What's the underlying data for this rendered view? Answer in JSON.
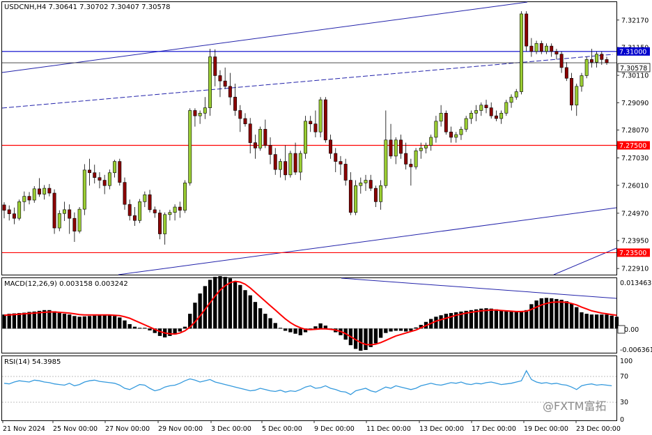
{
  "header": {
    "symbol_info": "USDCNH,H4  7.30641 7.30702 7.30407 7.30578"
  },
  "price_axis": {
    "ticks": [
      "7.32170",
      "7.31150",
      "7.30110",
      "7.29090",
      "7.28070",
      "7.27030",
      "7.26010",
      "7.24970",
      "7.23950",
      "7.22910"
    ],
    "current_price_label": "7.30578",
    "levels": [
      {
        "label": "7.31000",
        "value": 7.31,
        "color": "#0000cc"
      },
      {
        "label": "7.27500",
        "value": 7.275,
        "color": "#ff0000"
      },
      {
        "label": "7.23500",
        "value": 7.235,
        "color": "#ff0000"
      }
    ]
  },
  "macd": {
    "title": "MACD(12,26,9) 0.003158 0.003242",
    "ticks": [
      "0.013463",
      "0.00",
      "-0.006361"
    ]
  },
  "rsi": {
    "title": "RSI(14) 54.3985",
    "ticks": [
      "100",
      "70",
      "30",
      "0"
    ]
  },
  "time_axis": {
    "labels": [
      "21 Nov 2024",
      "25 Nov 00:00",
      "27 Nov 00:00",
      "29 Nov 00:00",
      "3 Dec 00:00",
      "5 Dec 00:00",
      "9 Dec 00:00",
      "11 Dec 00:00",
      "13 Dec 00:00",
      "17 Dec 00:00",
      "19 Dec 00:00",
      "23 Dec 00:00"
    ]
  },
  "watermark": "@FXTM富拓",
  "colors": {
    "bull": "#9acd32",
    "bear": "#8b0000",
    "signal": "#ff0000",
    "rsi": "#3399dd",
    "trend": "#2222aa"
  },
  "chart_data": {
    "type": "candlestick",
    "title": "USDCNH,H4",
    "ylim": [
      7.2268,
      7.3284
    ],
    "ohlc": [
      [
        7.2528,
        7.2538,
        7.2478,
        7.2508
      ],
      [
        7.251,
        7.2526,
        7.247,
        7.2495
      ],
      [
        7.2495,
        7.2518,
        7.2456,
        7.2478
      ],
      [
        7.2478,
        7.2548,
        7.247,
        7.254
      ],
      [
        7.254,
        7.2578,
        7.2505,
        7.256
      ],
      [
        7.256,
        7.2576,
        7.253,
        7.2546
      ],
      [
        7.2546,
        7.2598,
        7.2536,
        7.2588
      ],
      [
        7.2588,
        7.2628,
        7.2558,
        7.2568
      ],
      [
        7.2568,
        7.2602,
        7.2548,
        7.259
      ],
      [
        7.259,
        7.2606,
        7.256,
        7.2572
      ],
      [
        7.2572,
        7.2586,
        7.242,
        7.2442
      ],
      [
        7.2442,
        7.2508,
        7.243,
        7.2496
      ],
      [
        7.2496,
        7.254,
        7.2468,
        7.251
      ],
      [
        7.251,
        7.253,
        7.242,
        7.2478
      ],
      [
        7.2478,
        7.25,
        7.239,
        7.243
      ],
      [
        7.243,
        7.252,
        7.2422,
        7.2512
      ],
      [
        7.2512,
        7.268,
        7.249,
        7.2658
      ],
      [
        7.2658,
        7.27,
        7.26,
        7.2648
      ],
      [
        7.2648,
        7.2678,
        7.2608,
        7.263
      ],
      [
        7.263,
        7.265,
        7.259,
        7.262
      ],
      [
        7.262,
        7.264,
        7.2568,
        7.26
      ],
      [
        7.26,
        7.266,
        7.2586,
        7.2648
      ],
      [
        7.2648,
        7.2696,
        7.263,
        7.269
      ],
      [
        7.269,
        7.27,
        7.26,
        7.2612
      ],
      [
        7.2612,
        7.263,
        7.251,
        7.253
      ],
      [
        7.253,
        7.2548,
        7.247,
        7.2488
      ],
      [
        7.2488,
        7.252,
        7.245,
        7.247
      ],
      [
        7.247,
        7.255,
        7.246,
        7.254
      ],
      [
        7.254,
        7.2578,
        7.252,
        7.2566
      ],
      [
        7.2566,
        7.2584,
        7.25,
        7.251
      ],
      [
        7.251,
        7.2522,
        7.248,
        7.2498
      ],
      [
        7.2498,
        7.251,
        7.24,
        7.242
      ],
      [
        7.242,
        7.25,
        7.238,
        7.2492
      ],
      [
        7.2492,
        7.251,
        7.247,
        7.25
      ],
      [
        7.25,
        7.253,
        7.247,
        7.252
      ],
      [
        7.252,
        7.254,
        7.248,
        7.2508
      ],
      [
        7.2508,
        7.262,
        7.2498,
        7.261
      ],
      [
        7.261,
        7.2888,
        7.26,
        7.288
      ],
      [
        7.288,
        7.2888,
        7.282,
        7.286
      ],
      [
        7.286,
        7.288,
        7.283,
        7.287
      ],
      [
        7.287,
        7.293,
        7.2848,
        7.289
      ],
      [
        7.289,
        7.311,
        7.286,
        7.308
      ],
      [
        7.308,
        7.3108,
        7.297,
        7.301
      ],
      [
        7.301,
        7.303,
        7.293,
        7.299
      ],
      [
        7.299,
        7.304,
        7.296,
        7.297
      ],
      [
        7.297,
        7.302,
        7.29,
        7.293
      ],
      [
        7.293,
        7.298,
        7.286,
        7.288
      ],
      [
        7.288,
        7.29,
        7.28,
        7.285
      ],
      [
        7.285,
        7.287,
        7.282,
        7.283
      ],
      [
        7.283,
        7.2852,
        7.272,
        7.276
      ],
      [
        7.276,
        7.279,
        7.27,
        7.274
      ],
      [
        7.274,
        7.282,
        7.273,
        7.281
      ],
      [
        7.281,
        7.2846,
        7.274,
        7.275
      ],
      [
        7.275,
        7.278,
        7.268,
        7.2716
      ],
      [
        7.2716,
        7.274,
        7.264,
        7.266
      ],
      [
        7.266,
        7.27,
        7.263,
        7.269
      ],
      [
        7.269,
        7.275,
        7.262,
        7.264
      ],
      [
        7.264,
        7.273,
        7.263,
        7.272
      ],
      [
        7.272,
        7.276,
        7.264,
        7.265
      ],
      [
        7.265,
        7.273,
        7.262,
        7.272
      ],
      [
        7.272,
        7.286,
        7.27,
        7.284
      ],
      [
        7.284,
        7.286,
        7.28,
        7.283
      ],
      [
        7.283,
        7.288,
        7.278,
        7.28
      ],
      [
        7.28,
        7.293,
        7.278,
        7.292
      ],
      [
        7.292,
        7.293,
        7.276,
        7.277
      ],
      [
        7.277,
        7.279,
        7.27,
        7.272
      ],
      [
        7.272,
        7.274,
        7.265,
        7.269
      ],
      [
        7.269,
        7.271,
        7.264,
        7.268
      ],
      [
        7.268,
        7.27,
        7.26,
        7.262
      ],
      [
        7.262,
        7.265,
        7.249,
        7.25
      ],
      [
        7.25,
        7.262,
        7.249,
        7.26
      ],
      [
        7.26,
        7.263,
        7.257,
        7.261
      ],
      [
        7.261,
        7.264,
        7.258,
        7.262
      ],
      [
        7.262,
        7.264,
        7.258,
        7.259
      ],
      [
        7.259,
        7.26,
        7.252,
        7.254
      ],
      [
        7.254,
        7.262,
        7.251,
        7.26
      ],
      [
        7.26,
        7.288,
        7.259,
        7.277
      ],
      [
        7.277,
        7.283,
        7.27,
        7.271
      ],
      [
        7.271,
        7.278,
        7.268,
        7.277
      ],
      [
        7.277,
        7.279,
        7.27,
        7.272
      ],
      [
        7.272,
        7.276,
        7.266,
        7.268
      ],
      [
        7.268,
        7.27,
        7.26,
        7.267
      ],
      [
        7.267,
        7.274,
        7.266,
        7.273
      ],
      [
        7.273,
        7.276,
        7.27,
        7.274
      ],
      [
        7.274,
        7.276,
        7.272,
        7.275
      ],
      [
        7.275,
        7.279,
        7.273,
        7.278
      ],
      [
        7.278,
        7.286,
        7.276,
        7.284
      ],
      [
        7.284,
        7.29,
        7.282,
        7.287
      ],
      [
        7.287,
        7.288,
        7.279,
        7.28
      ],
      [
        7.28,
        7.282,
        7.276,
        7.278
      ],
      [
        7.278,
        7.28,
        7.276,
        7.279
      ],
      [
        7.279,
        7.282,
        7.277,
        7.281
      ],
      [
        7.281,
        7.286,
        7.28,
        7.285
      ],
      [
        7.285,
        7.288,
        7.283,
        7.287
      ],
      [
        7.287,
        7.29,
        7.284,
        7.288
      ],
      [
        7.288,
        7.291,
        7.286,
        7.29
      ],
      [
        7.29,
        7.292,
        7.287,
        7.289
      ],
      [
        7.289,
        7.291,
        7.285,
        7.286
      ],
      [
        7.286,
        7.288,
        7.284,
        7.285
      ],
      [
        7.285,
        7.288,
        7.283,
        7.287
      ],
      [
        7.287,
        7.292,
        7.286,
        7.291
      ],
      [
        7.291,
        7.294,
        7.289,
        7.293
      ],
      [
        7.293,
        7.296,
        7.292,
        7.295
      ],
      [
        7.295,
        7.325,
        7.294,
        7.324
      ],
      [
        7.324,
        7.325,
        7.31,
        7.312
      ],
      [
        7.312,
        7.315,
        7.308,
        7.31
      ],
      [
        7.31,
        7.314,
        7.309,
        7.313
      ],
      [
        7.313,
        7.314,
        7.309,
        7.31
      ],
      [
        7.31,
        7.313,
        7.309,
        7.312
      ],
      [
        7.312,
        7.313,
        7.308,
        7.31
      ],
      [
        7.31,
        7.311,
        7.307,
        7.309
      ],
      [
        7.309,
        7.31,
        7.302,
        7.304
      ],
      [
        7.304,
        7.306,
        7.299,
        7.3
      ],
      [
        7.3,
        7.302,
        7.288,
        7.29
      ],
      [
        7.29,
        7.298,
        7.286,
        7.297
      ],
      [
        7.297,
        7.302,
        7.295,
        7.301
      ],
      [
        7.301,
        7.308,
        7.3,
        7.307
      ],
      [
        7.307,
        7.311,
        7.304,
        7.306
      ],
      [
        7.306,
        7.31,
        7.304,
        7.309
      ],
      [
        7.309,
        7.31,
        7.305,
        7.307
      ],
      [
        7.307,
        7.308,
        7.305,
        7.3058
      ]
    ],
    "macd": {
      "histogram": [
        0.0038,
        0.004,
        0.0041,
        0.0042,
        0.0043,
        0.0045,
        0.0046,
        0.0048,
        0.005,
        0.005,
        0.0047,
        0.0042,
        0.004,
        0.0038,
        0.0034,
        0.0032,
        0.0033,
        0.0034,
        0.0035,
        0.0036,
        0.0037,
        0.0036,
        0.0034,
        0.003,
        0.0022,
        0.0012,
        0.0005,
        0.0002,
        0.0002,
        -0.0005,
        -0.0012,
        -0.002,
        -0.0024,
        -0.002,
        -0.0016,
        -0.0008,
        0.0005,
        0.004,
        0.007,
        0.0095,
        0.0115,
        0.0132,
        0.014,
        0.0142,
        0.014,
        0.0136,
        0.0128,
        0.0118,
        0.0104,
        0.009,
        0.0072,
        0.0055,
        0.004,
        0.0028,
        0.0015,
        0.0002,
        -0.0006,
        -0.001,
        -0.0014,
        -0.0018,
        -0.001,
        -0.0004,
        0.0006,
        0.0014,
        0.0008,
        -0.0002,
        -0.001,
        -0.0018,
        -0.003,
        -0.0045,
        -0.0055,
        -0.006,
        -0.0058,
        -0.005,
        -0.004,
        -0.0025,
        -0.0012,
        -0.0008,
        -0.0006,
        -0.0006,
        -0.0008,
        -0.0006,
        0.0003,
        0.001,
        0.0018,
        0.0026,
        0.0032,
        0.0036,
        0.004,
        0.0042,
        0.0044,
        0.0046,
        0.0048,
        0.005,
        0.0052,
        0.0054,
        0.0055,
        0.0054,
        0.0052,
        0.005,
        0.0047,
        0.0046,
        0.0045,
        0.0046,
        0.005,
        0.0066,
        0.0076,
        0.0082,
        0.0083,
        0.0082,
        0.008,
        0.0078,
        0.0074,
        0.0068,
        0.0058,
        0.0044,
        0.004,
        0.0038,
        0.0038,
        0.0038,
        0.0038,
        0.0035,
        0.0032
      ],
      "signal": [
        0.0036,
        0.0037,
        0.0038,
        0.0039,
        0.004,
        0.0041,
        0.0042,
        0.0043,
        0.0044,
        0.0045,
        0.0045,
        0.0044,
        0.0043,
        0.0042,
        0.004,
        0.0038,
        0.0037,
        0.0037,
        0.0037,
        0.0037,
        0.0037,
        0.0037,
        0.0036,
        0.0035,
        0.0032,
        0.0028,
        0.0022,
        0.0016,
        0.001,
        0.0004,
        -0.0002,
        -0.0008,
        -0.0012,
        -0.0014,
        -0.0015,
        -0.0012,
        -0.0006,
        0.0004,
        0.0018,
        0.0034,
        0.0052,
        0.007,
        0.0088,
        0.0104,
        0.0116,
        0.0124,
        0.0128,
        0.0126,
        0.012,
        0.011,
        0.0098,
        0.0086,
        0.0074,
        0.0062,
        0.005,
        0.0038,
        0.0026,
        0.0016,
        0.0008,
        0.0002,
        -0.0002,
        -0.0003,
        -0.0002,
        -0.0001,
        -0.0001,
        -0.0002,
        -0.0004,
        -0.0008,
        -0.0014,
        -0.0022,
        -0.003,
        -0.0038,
        -0.0043,
        -0.0044,
        -0.0042,
        -0.0038,
        -0.0032,
        -0.0026,
        -0.002,
        -0.0016,
        -0.0012,
        -0.0008,
        -0.0004,
        0.0002,
        0.0008,
        0.0014,
        0.002,
        0.0024,
        0.0028,
        0.0032,
        0.0036,
        0.0039,
        0.0042,
        0.0044,
        0.0046,
        0.0048,
        0.0049,
        0.005,
        0.005,
        0.0049,
        0.0048,
        0.0047,
        0.0046,
        0.0046,
        0.0047,
        0.0052,
        0.0058,
        0.0064,
        0.0068,
        0.0071,
        0.0072,
        0.0072,
        0.0071,
        0.0068,
        0.0064,
        0.0058,
        0.0053,
        0.0048,
        0.0045,
        0.0042,
        0.004,
        0.0038,
        0.0036
      ]
    },
    "rsi": [
      58,
      57,
      60,
      62,
      61,
      60,
      63,
      62,
      60,
      59,
      57,
      56,
      55,
      58,
      54,
      56,
      60,
      62,
      63,
      61,
      60,
      59,
      58,
      55,
      50,
      48,
      52,
      56,
      55,
      50,
      46,
      48,
      52,
      54,
      55,
      58,
      62,
      65,
      63,
      60,
      62,
      64,
      60,
      58,
      56,
      54,
      52,
      50,
      48,
      46,
      47,
      50,
      48,
      46,
      45,
      47,
      44,
      46,
      45,
      48,
      52,
      54,
      50,
      51,
      54,
      50,
      48,
      45,
      44,
      40,
      46,
      48,
      50,
      46,
      44,
      48,
      52,
      50,
      54,
      52,
      50,
      48,
      50,
      54,
      56,
      58,
      56,
      55,
      57,
      59,
      58,
      60,
      57,
      56,
      58,
      57,
      59,
      60,
      58,
      56,
      57,
      58,
      60,
      62,
      78,
      64,
      60,
      58,
      59,
      57,
      58,
      56,
      55,
      52,
      48,
      54,
      56,
      57,
      55,
      56,
      55,
      54
    ]
  }
}
